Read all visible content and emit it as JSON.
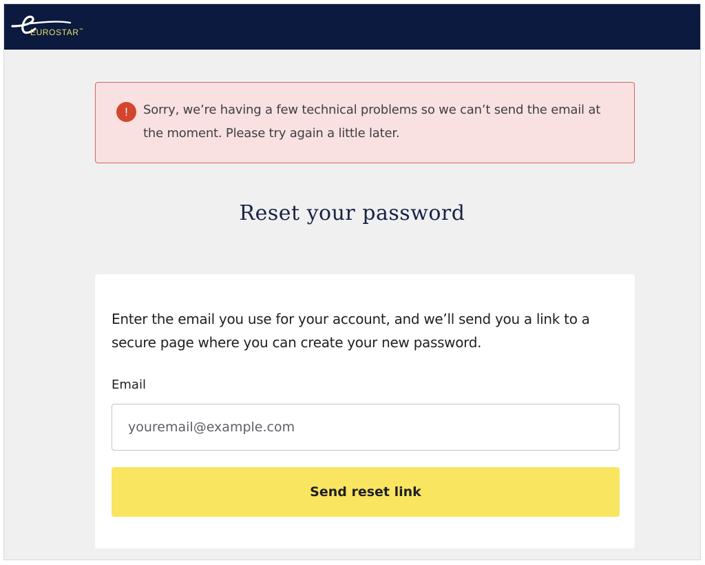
{
  "header": {
    "logo": {
      "text": "EUROSTAR",
      "trademark": "™",
      "icon": "eurostar-e-logo",
      "color": "#e8e06a"
    },
    "background": "#0b1a3e"
  },
  "alert": {
    "icon": "exclamation-circle-icon",
    "icon_glyph": "!",
    "icon_color": "#d3452e",
    "background": "#f8e1e0",
    "message": "Sorry, we’re having a few technical problems so we can’t send the email at the moment. Please try again a little later."
  },
  "page": {
    "title": "Reset your password"
  },
  "form": {
    "description": "Enter the email you use for your account, and we’ll send you a link to a secure page where you can create your new password.",
    "email_label": "Email",
    "email_value": "",
    "email_placeholder": "youremail@example.com",
    "submit_label": "Send reset link",
    "submit_color": "#f9e55f"
  }
}
